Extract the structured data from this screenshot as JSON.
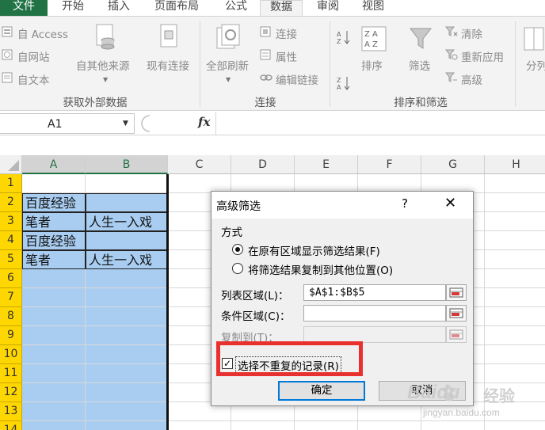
{
  "tabs": {
    "file": "文件",
    "home": "开始",
    "insert": "插入",
    "layout": "页面布局",
    "formulas": "公式",
    "data": "数据",
    "review": "审阅",
    "view": "视图"
  },
  "ribbon": {
    "from_access": "自 Access",
    "from_web": "自网站",
    "from_text": "自文本",
    "from_other": "自其他来源",
    "existing": "现有连接",
    "group_external": "获取外部数据",
    "refresh_all": "全部刷新",
    "connections": "连接",
    "properties": "属性",
    "edit_links": "编辑链接",
    "group_connections": "连接",
    "sort": "排序",
    "filter": "筛选",
    "clear": "清除",
    "reapply": "重新应用",
    "advanced": "高级",
    "group_sort_filter": "排序和筛选",
    "split": "分列"
  },
  "formula_bar": {
    "name_box": "A1",
    "fx": "fx"
  },
  "grid": {
    "columns": [
      "A",
      "B",
      "C",
      "D",
      "E",
      "F",
      "G",
      "H"
    ],
    "rows": [
      "1",
      "2",
      "3",
      "4",
      "5",
      "6",
      "7",
      "8",
      "9",
      "10",
      "11",
      "12",
      "13",
      "14"
    ],
    "cells": [
      [
        "",
        ""
      ],
      [
        "百度经验",
        ""
      ],
      [
        "笔者",
        "人生一入戏"
      ],
      [
        "百度经验",
        ""
      ],
      [
        "笔者",
        "人生一入戏"
      ]
    ]
  },
  "dialog": {
    "title": "高级筛选",
    "help": "?",
    "close": "✕",
    "mode_label": "方式",
    "option_inplace": "在原有区域显示筛选结果(F)",
    "option_copy": "将筛选结果复制到其他位置(O)",
    "list_range_label": "列表区域(L)：",
    "list_range_value": "$A$1:$B$5",
    "criteria_label": "条件区域(C)：",
    "criteria_value": "",
    "copy_to_label": "复制到(T)：",
    "copy_to_value": "",
    "unique_label": "选择不重复的记录(R)",
    "unique_checked": true,
    "ok": "确定",
    "cancel": "取消"
  },
  "watermark": {
    "brand": "Baidu",
    "suffix": "经验",
    "url": "jingyan.baidu.com"
  },
  "colors": {
    "excel_green": "#217346",
    "selection_blue": "#a9cdf0",
    "row_header_yellow": "#ffd700",
    "highlight_red": "#e8312f",
    "focus_blue": "#0078d7"
  }
}
